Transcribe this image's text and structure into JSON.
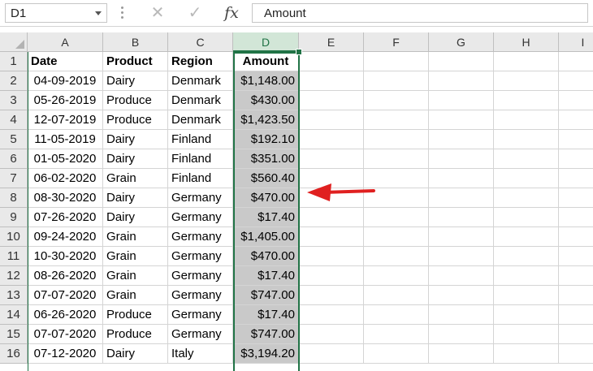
{
  "name_box": {
    "value": "D1"
  },
  "formula_bar": {
    "cancel_glyph": "✕",
    "enter_glyph": "✓",
    "function_glyph": "fx",
    "content": "Amount"
  },
  "columns": [
    "A",
    "B",
    "C",
    "D",
    "E",
    "F",
    "G",
    "H",
    "I"
  ],
  "selected_column": "D",
  "rows": [
    "1",
    "2",
    "3",
    "4",
    "5",
    "6",
    "7",
    "8",
    "9",
    "10",
    "11",
    "12",
    "13",
    "14",
    "15",
    "16"
  ],
  "table": {
    "headers": [
      "Date",
      "Product",
      "Region",
      "Amount"
    ],
    "records": [
      [
        "04-09-2019",
        "Dairy",
        "Denmark",
        "$1,148.00"
      ],
      [
        "05-26-2019",
        "Produce",
        "Denmark",
        "$430.00"
      ],
      [
        "12-07-2019",
        "Produce",
        "Denmark",
        "$1,423.50"
      ],
      [
        "11-05-2019",
        "Dairy",
        "Finland",
        "$192.10"
      ],
      [
        "01-05-2020",
        "Dairy",
        "Finland",
        "$351.00"
      ],
      [
        "06-02-2020",
        "Grain",
        "Finland",
        "$560.40"
      ],
      [
        "08-30-2020",
        "Dairy",
        "Germany",
        "$470.00"
      ],
      [
        "07-26-2020",
        "Dairy",
        "Germany",
        "$17.40"
      ],
      [
        "09-24-2020",
        "Grain",
        "Germany",
        "$1,405.00"
      ],
      [
        "10-30-2020",
        "Grain",
        "Germany",
        "$470.00"
      ],
      [
        "08-26-2020",
        "Grain",
        "Germany",
        "$17.40"
      ],
      [
        "07-07-2020",
        "Grain",
        "Germany",
        "$747.00"
      ],
      [
        "06-26-2020",
        "Produce",
        "Germany",
        "$17.40"
      ],
      [
        "07-07-2020",
        "Produce",
        "Germany",
        "$747.00"
      ],
      [
        "07-12-2020",
        "Dairy",
        "Italy",
        "$3,194.20"
      ]
    ]
  },
  "colors": {
    "accent_green": "#217346",
    "selection_fill": "#c9c9c9",
    "annotation_arrow": "#e02020"
  }
}
